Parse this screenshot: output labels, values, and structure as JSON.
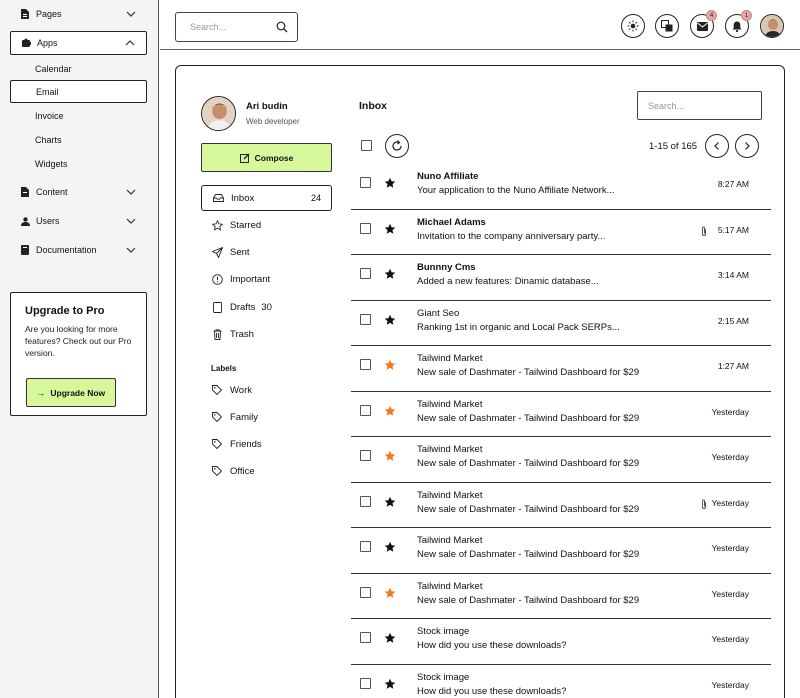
{
  "sidebar": {
    "pages": "Pages",
    "apps": "Apps",
    "app_items": [
      "Calendar",
      "Email",
      "Invoice",
      "Charts",
      "Widgets"
    ],
    "content": "Content",
    "users": "Users",
    "documentation": "Documentation",
    "promo": {
      "title": "Upgrade to Pro",
      "text": "Are you looking for more features? Check out our Pro version.",
      "button": "Upgrade Now"
    }
  },
  "topbar": {
    "search_placeholder": "Search...",
    "mail_badge": "4",
    "bell_badge": "1"
  },
  "profile": {
    "name": "Ari budin",
    "role": "Web developer"
  },
  "compose_label": "Compose",
  "folders": {
    "inbox": "Inbox",
    "inbox_count": "24",
    "starred": "Starred",
    "sent": "Sent",
    "important": "Important",
    "drafts": "Drafts",
    "drafts_count": "30",
    "trash": "Trash"
  },
  "labels": {
    "title": "Labels",
    "items": [
      "Work",
      "Family",
      "Friends",
      "Office"
    ]
  },
  "inbox": {
    "title": "Inbox",
    "search_placeholder": "Search...",
    "page_info": "1-15 of 165"
  },
  "colors": {
    "accent": "#d7f89a",
    "star_dark": "#111111",
    "star_orange": "#f07a1f",
    "badge": "#f8a0a0"
  },
  "emails": [
    {
      "sender": "Nuno Affiliate",
      "subject": "Your application to the Nuno Affiliate Network...",
      "time": "8:27 AM",
      "bold": true,
      "star": "dark",
      "attachment": false
    },
    {
      "sender": "Michael Adams",
      "subject": "Invitation to the company anniversary party...",
      "time": "5:17 AM",
      "bold": true,
      "star": "dark",
      "attachment": true
    },
    {
      "sender": "Bunnny Cms",
      "subject": "Added a new features: Dinamic database...",
      "time": "3:14 AM",
      "bold": true,
      "star": "dark",
      "attachment": false
    },
    {
      "sender": "Giant Seo",
      "subject": "Ranking 1st in organic and Local Pack SERPs...",
      "time": "2:15 AM",
      "bold": false,
      "star": "dark",
      "attachment": false
    },
    {
      "sender": "Tailwind Market",
      "subject": "New sale of Dashmater - Tailwind Dashboard for $29",
      "time": "1:27 AM",
      "bold": false,
      "star": "orange",
      "attachment": false
    },
    {
      "sender": "Tailwind Market",
      "subject": "New sale of Dashmater - Tailwind Dashboard for $29",
      "time": "Yesterday",
      "bold": false,
      "star": "orange",
      "attachment": false
    },
    {
      "sender": "Tailwind Market",
      "subject": "New sale of Dashmater - Tailwind Dashboard for $29",
      "time": "Yesterday",
      "bold": false,
      "star": "orange",
      "attachment": false
    },
    {
      "sender": "Tailwind Market",
      "subject": "New sale of Dashmater - Tailwind Dashboard for $29",
      "time": "Yesterday",
      "bold": false,
      "star": "dark",
      "attachment": true
    },
    {
      "sender": "Tailwind Market",
      "subject": "New sale of Dashmater - Tailwind Dashboard for $29",
      "time": "Yesterday",
      "bold": false,
      "star": "dark",
      "attachment": false
    },
    {
      "sender": "Tailwind Market",
      "subject": "New sale of Dashmater - Tailwind Dashboard for $29",
      "time": "Yesterday",
      "bold": false,
      "star": "orange",
      "attachment": false
    },
    {
      "sender": "Stock image",
      "subject": "How did you use these downloads?",
      "time": "Yesterday",
      "bold": false,
      "star": "dark",
      "attachment": false
    },
    {
      "sender": "Stock image",
      "subject": "How did you use these downloads?",
      "time": "Yesterday",
      "bold": false,
      "star": "dark",
      "attachment": false
    }
  ]
}
